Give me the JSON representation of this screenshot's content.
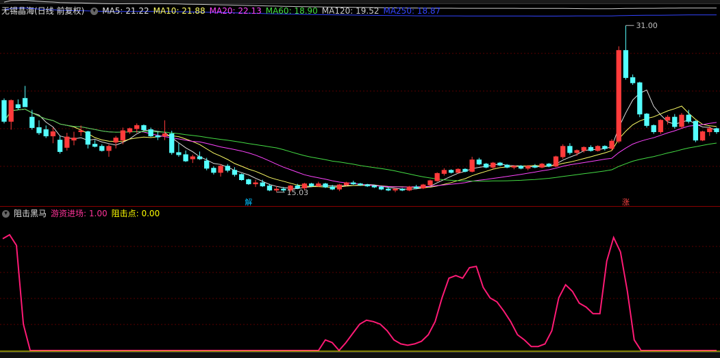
{
  "chart_data": [
    {
      "type": "candlestick",
      "title": "无锡晶海(日线 前复权)",
      "ylim": [
        14,
        32
      ],
      "ma_legend": [
        {
          "name": "MA5",
          "value": "21.22",
          "color": "#e0e0e0"
        },
        {
          "name": "MA10",
          "value": "21.88",
          "color": "#ffff66"
        },
        {
          "name": "MA20",
          "value": "22.13",
          "color": "#ff44ff"
        },
        {
          "name": "MA60",
          "value": "18.90",
          "color": "#44dd44"
        },
        {
          "name": "MA120",
          "value": "19.52",
          "color": "#cccccc"
        },
        {
          "name": "MA250",
          "value": "18.87",
          "color": "#3344ff"
        }
      ],
      "candles": [
        [
          23.8,
          24.0,
          21.6,
          21.8
        ],
        [
          21.8,
          23.9,
          21.0,
          23.8
        ],
        [
          23.4,
          23.9,
          22.9,
          23.1
        ],
        [
          24.0,
          25.2,
          23.4,
          23.2
        ],
        [
          22.2,
          22.9,
          21.0,
          21.2
        ],
        [
          21.2,
          21.9,
          20.5,
          20.7
        ],
        [
          21.0,
          21.4,
          20.2,
          20.4
        ],
        [
          20.4,
          21.2,
          19.7,
          20.8
        ],
        [
          20.0,
          20.4,
          18.7,
          18.9
        ],
        [
          19.3,
          20.7,
          19.0,
          20.3
        ],
        [
          20.0,
          20.8,
          19.5,
          20.2
        ],
        [
          20.8,
          21.4,
          20.4,
          20.9
        ],
        [
          20.8,
          20.9,
          19.2,
          19.6
        ],
        [
          19.6,
          20.0,
          19.3,
          19.4
        ],
        [
          19.4,
          19.6,
          18.9,
          19.0
        ],
        [
          19.0,
          19.6,
          18.4,
          19.4
        ],
        [
          19.8,
          20.4,
          19.2,
          20.2
        ],
        [
          20.0,
          21.2,
          19.6,
          20.9
        ],
        [
          20.8,
          21.2,
          20.6,
          21.1
        ],
        [
          21.1,
          21.6,
          20.7,
          21.4
        ],
        [
          21.4,
          21.5,
          20.9,
          21.0
        ],
        [
          21.0,
          21.2,
          20.3,
          20.4
        ],
        [
          20.4,
          20.8,
          20.0,
          20.3
        ],
        [
          20.4,
          21.9,
          20.0,
          20.6
        ],
        [
          20.6,
          20.9,
          18.6,
          18.8
        ],
        [
          18.8,
          19.7,
          18.4,
          18.6
        ],
        [
          18.6,
          19.0,
          17.9,
          18.0
        ],
        [
          18.2,
          18.6,
          17.8,
          18.4
        ],
        [
          18.4,
          18.9,
          18.1,
          18.2
        ],
        [
          18.0,
          18.3,
          17.1,
          17.3
        ],
        [
          17.3,
          17.5,
          16.7,
          16.9
        ],
        [
          16.9,
          17.7,
          16.5,
          17.5
        ],
        [
          17.5,
          17.7,
          16.9,
          17.1
        ],
        [
          17.1,
          17.4,
          16.5,
          16.7
        ],
        [
          16.7,
          16.8,
          16.1,
          16.2
        ],
        [
          16.2,
          16.3,
          15.7,
          15.8
        ],
        [
          15.8,
          16.2,
          15.5,
          15.9
        ],
        [
          15.9,
          16.2,
          15.5,
          15.6
        ],
        [
          15.6,
          15.8,
          15.1,
          15.2
        ],
        [
          15.2,
          15.6,
          15.0,
          15.3
        ],
        [
          15.3,
          15.5,
          15.03,
          15.2
        ],
        [
          15.2,
          15.7,
          15.0,
          15.6
        ],
        [
          15.6,
          15.8,
          15.3,
          15.4
        ],
        [
          15.4,
          15.9,
          15.2,
          15.8
        ],
        [
          15.8,
          15.9,
          15.5,
          15.6
        ],
        [
          15.6,
          16.0,
          15.5,
          15.8
        ],
        [
          15.8,
          15.9,
          15.4,
          15.5
        ],
        [
          15.5,
          15.7,
          15.2,
          15.3
        ],
        [
          15.3,
          15.8,
          15.1,
          15.7
        ],
        [
          15.7,
          16.0,
          15.6,
          15.9
        ],
        [
          15.9,
          16.1,
          15.7,
          15.8
        ],
        [
          15.8,
          15.9,
          15.6,
          15.7
        ],
        [
          15.7,
          15.8,
          15.5,
          15.6
        ],
        [
          15.6,
          15.7,
          15.4,
          15.5
        ],
        [
          15.5,
          15.6,
          15.2,
          15.3
        ],
        [
          15.3,
          15.5,
          15.1,
          15.2
        ],
        [
          15.2,
          15.4,
          15.0,
          15.3
        ],
        [
          15.3,
          15.4,
          15.1,
          15.2
        ],
        [
          15.2,
          15.6,
          15.1,
          15.5
        ],
        [
          15.5,
          15.7,
          15.3,
          15.4
        ],
        [
          15.4,
          15.8,
          15.3,
          15.7
        ],
        [
          15.7,
          16.2,
          15.6,
          16.1
        ],
        [
          16.1,
          16.9,
          16.0,
          16.8
        ],
        [
          16.8,
          17.3,
          16.6,
          17.1
        ],
        [
          17.1,
          17.2,
          16.8,
          16.9
        ],
        [
          16.9,
          17.3,
          16.8,
          17.2
        ],
        [
          17.2,
          17.3,
          16.9,
          17.0
        ],
        [
          17.0,
          18.4,
          16.9,
          18.1
        ],
        [
          18.1,
          18.3,
          17.6,
          17.7
        ],
        [
          17.7,
          17.8,
          17.3,
          17.4
        ],
        [
          17.4,
          17.9,
          17.2,
          17.8
        ],
        [
          17.8,
          17.9,
          17.5,
          17.6
        ],
        [
          17.6,
          17.7,
          17.3,
          17.4
        ],
        [
          17.4,
          17.6,
          17.2,
          17.5
        ],
        [
          17.5,
          17.6,
          17.2,
          17.3
        ],
        [
          17.3,
          17.6,
          17.1,
          17.5
        ],
        [
          17.5,
          17.7,
          17.3,
          17.4
        ],
        [
          17.4,
          17.8,
          17.3,
          17.7
        ],
        [
          17.7,
          17.8,
          17.4,
          17.5
        ],
        [
          17.5,
          18.5,
          17.4,
          18.4
        ],
        [
          18.4,
          19.6,
          18.2,
          19.4
        ],
        [
          19.4,
          19.7,
          18.6,
          18.8
        ],
        [
          18.8,
          19.1,
          18.5,
          19.0
        ],
        [
          19.0,
          19.4,
          18.8,
          19.3
        ],
        [
          19.3,
          19.5,
          18.9,
          19.0
        ],
        [
          19.0,
          19.5,
          18.9,
          19.4
        ],
        [
          19.4,
          19.5,
          19.0,
          19.2
        ],
        [
          19.2,
          20.1,
          19.0,
          19.9
        ],
        [
          19.9,
          29.0,
          19.7,
          28.6
        ],
        [
          28.6,
          31.0,
          25.8,
          26.0
        ],
        [
          26.0,
          26.3,
          25.3,
          25.5
        ],
        [
          25.5,
          25.6,
          22.2,
          22.5
        ],
        [
          22.5,
          22.6,
          21.2,
          21.4
        ],
        [
          21.4,
          21.5,
          20.6,
          20.8
        ],
        [
          20.8,
          22.0,
          20.6,
          21.9
        ],
        [
          21.9,
          22.4,
          21.5,
          22.2
        ],
        [
          22.2,
          22.5,
          21.1,
          21.3
        ],
        [
          21.3,
          22.6,
          21.1,
          22.4
        ],
        [
          22.4,
          22.9,
          21.6,
          21.8
        ],
        [
          21.8,
          21.9,
          19.8,
          20.0
        ],
        [
          20.0,
          20.9,
          19.9,
          20.8
        ],
        [
          20.8,
          21.3,
          20.4,
          21.1
        ],
        [
          21.1,
          21.2,
          20.6,
          20.8
        ]
      ],
      "annotations": [
        {
          "label": "31.00",
          "kind": "high"
        },
        {
          "label": "15.03",
          "kind": "low"
        },
        {
          "label": "解",
          "kind": "signal",
          "color": "#00bfff"
        },
        {
          "label": "涨",
          "kind": "signal",
          "color": "#ff4444"
        }
      ]
    },
    {
      "type": "line",
      "title": "阻击黑马",
      "indicators": [
        {
          "name": "游资进场",
          "value": "1.00",
          "color": "#ff3399"
        },
        {
          "name": "阻击点",
          "value": "0.00",
          "color": "#ffff00"
        }
      ],
      "ylim": [
        0,
        100
      ],
      "series": [
        {
          "color": "#ff1a75",
          "values": [
            85,
            88,
            80,
            20,
            0,
            0,
            0,
            0,
            0,
            0,
            0,
            0,
            0,
            0,
            0,
            0,
            0,
            0,
            0,
            0,
            0,
            0,
            0,
            0,
            0,
            0,
            0,
            0,
            0,
            0,
            0,
            0,
            0,
            0,
            0,
            0,
            0,
            0,
            0,
            0,
            0,
            0,
            0,
            0,
            0,
            0,
            0,
            8,
            6,
            0,
            6,
            13,
            20,
            23,
            22,
            20,
            15,
            8,
            5,
            4,
            5,
            7,
            12,
            22,
            40,
            55,
            57,
            55,
            63,
            64,
            48,
            40,
            37,
            30,
            22,
            12,
            8,
            3,
            3,
            5,
            15,
            40,
            50,
            45,
            36,
            33,
            28,
            28,
            68,
            86,
            75,
            45,
            8,
            0,
            0,
            0,
            0,
            0,
            0,
            0,
            0,
            0,
            0,
            0,
            0
          ]
        }
      ]
    }
  ]
}
